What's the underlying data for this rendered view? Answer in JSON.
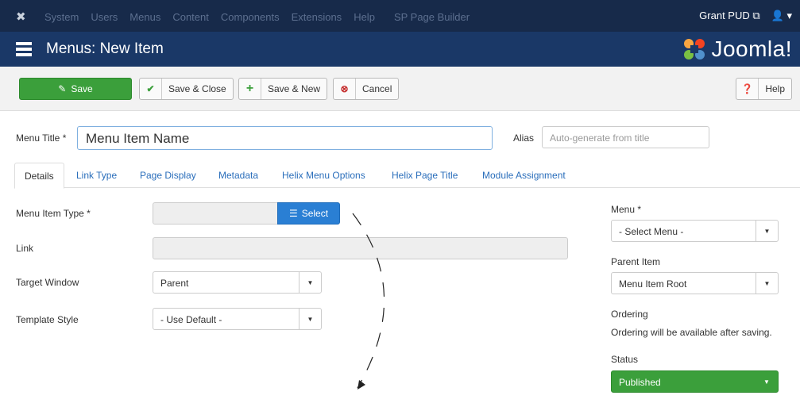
{
  "topbar": {
    "menu": [
      "System",
      "Users",
      "Menus",
      "Content",
      "Components",
      "Extensions",
      "Help",
      "SP Page Builder"
    ],
    "site_link": "Grant PUD",
    "user_icon": "user-icon"
  },
  "header": {
    "title": "Menus: New Item",
    "logo_text": "Joomla!"
  },
  "toolbar": {
    "save": "Save",
    "save_close": "Save & Close",
    "save_new": "Save & New",
    "cancel": "Cancel",
    "help": "Help"
  },
  "form": {
    "menu_title_label": "Menu Title *",
    "menu_title_value": "Menu Item Name",
    "alias_label": "Alias",
    "alias_placeholder": "Auto-generate from title"
  },
  "tabs": [
    "Details",
    "Link Type",
    "Page Display",
    "Metadata",
    "Helix Menu Options",
    "Helix Page Title",
    "Module Assignment"
  ],
  "details": {
    "menu_item_type_label": "Menu Item Type *",
    "select_button": "Select",
    "link_label": "Link",
    "target_window_label": "Target Window",
    "target_window_value": "Parent",
    "template_style_label": "Template Style",
    "template_style_value": "- Use Default -"
  },
  "sidebar": {
    "menu_label": "Menu *",
    "menu_value": "- Select Menu -",
    "parent_label": "Parent Item",
    "parent_value": "Menu Item Root",
    "ordering_label": "Ordering",
    "ordering_note": "Ordering will be available after saving.",
    "status_label": "Status",
    "status_value": "Published"
  },
  "colors": {
    "topbar": "#172a4a",
    "header": "#1a3867",
    "save_green": "#3b9f3b",
    "select_blue": "#2a7fd4",
    "published_green": "#3b9f3b"
  }
}
